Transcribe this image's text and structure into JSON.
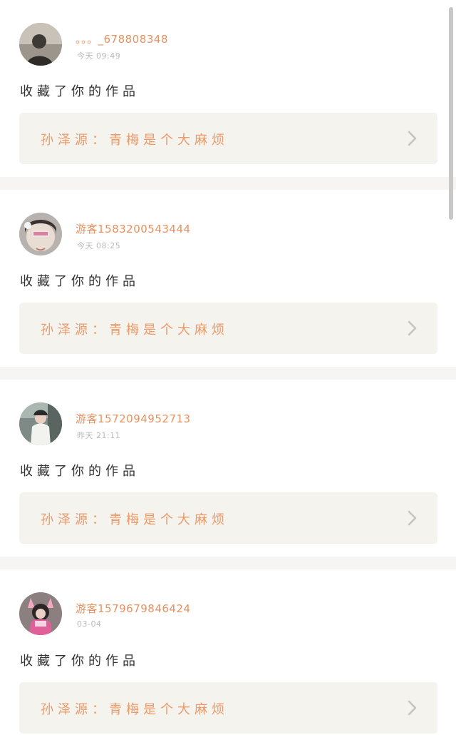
{
  "colors": {
    "accent": "#e8905e",
    "work_bg": "#f4f3ee",
    "time": "#b9b9b9",
    "text": "#333333"
  },
  "notifications": [
    {
      "username": "。。。_678808348",
      "time": "今天 09:49",
      "action": "收藏了你的作品",
      "work_title": "孙泽源：青梅是个大麻烦",
      "avatar_icon": "user-avatar-dark-silhouette"
    },
    {
      "username": "游客1583200543444",
      "time": "今天 08:25",
      "action": "收藏了你的作品",
      "work_title": "孙泽源：青梅是个大麻烦",
      "avatar_icon": "user-avatar-girl-headband"
    },
    {
      "username": "游客1572094952713",
      "time": "昨天 21:11",
      "action": "收藏了你的作品",
      "work_title": "孙泽源：青梅是个大麻烦",
      "avatar_icon": "user-avatar-girl-cap"
    },
    {
      "username": "游客1579679846424",
      "time": "03-04",
      "action": "收藏了你的作品",
      "work_title": "孙泽源：青梅是个大麻烦",
      "avatar_icon": "user-avatar-girl-pink-ears"
    }
  ]
}
